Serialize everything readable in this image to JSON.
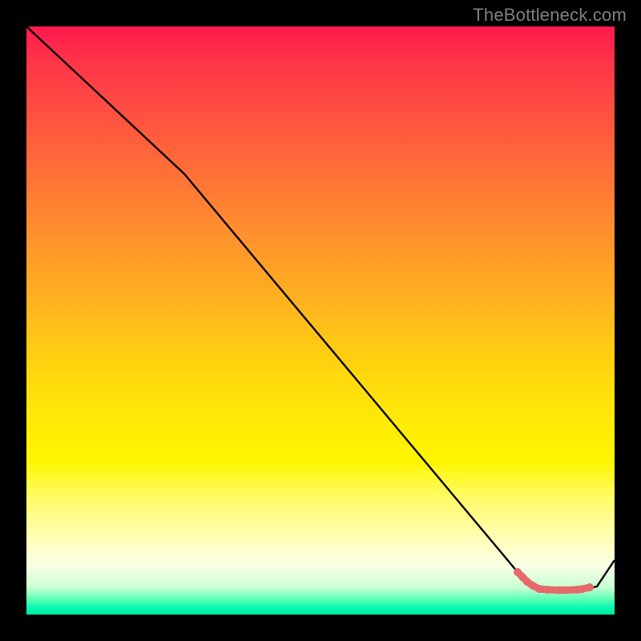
{
  "watermark": "TheBottleneck.com",
  "chart_data": {
    "type": "line",
    "title": "",
    "xlabel": "",
    "ylabel": "",
    "xlim": [
      0,
      1
    ],
    "ylim": [
      0,
      1
    ],
    "background_gradient": {
      "top": "#ff1a4e",
      "mid_upper": "#ff8a30",
      "mid": "#fff600",
      "mid_lower": "#ffffcc",
      "bottom": "#00e79e"
    },
    "series": [
      {
        "name": "bottleneck-curve",
        "color": "#000000",
        "points": [
          {
            "x": 0.0,
            "y": 1.0
          },
          {
            "x": 0.268,
            "y": 0.75
          },
          {
            "x": 0.835,
            "y": 0.072
          },
          {
            "x": 0.852,
            "y": 0.056
          },
          {
            "x": 0.872,
            "y": 0.046
          },
          {
            "x": 0.893,
            "y": 0.042
          },
          {
            "x": 0.934,
            "y": 0.042
          },
          {
            "x": 0.959,
            "y": 0.048
          },
          {
            "x": 1.0,
            "y": 0.093
          }
        ]
      },
      {
        "name": "marker-cluster",
        "color": "#e56a6a",
        "style": "thick-markers",
        "points": [
          {
            "x": 0.836,
            "y": 0.07
          },
          {
            "x": 0.844,
            "y": 0.062
          },
          {
            "x": 0.852,
            "y": 0.055
          },
          {
            "x": 0.862,
            "y": 0.049
          },
          {
            "x": 0.872,
            "y": 0.045
          },
          {
            "x": 0.886,
            "y": 0.042
          },
          {
            "x": 0.906,
            "y": 0.041
          },
          {
            "x": 0.916,
            "y": 0.041
          },
          {
            "x": 0.935,
            "y": 0.042
          },
          {
            "x": 0.944,
            "y": 0.043
          },
          {
            "x": 0.957,
            "y": 0.046
          }
        ]
      }
    ]
  }
}
